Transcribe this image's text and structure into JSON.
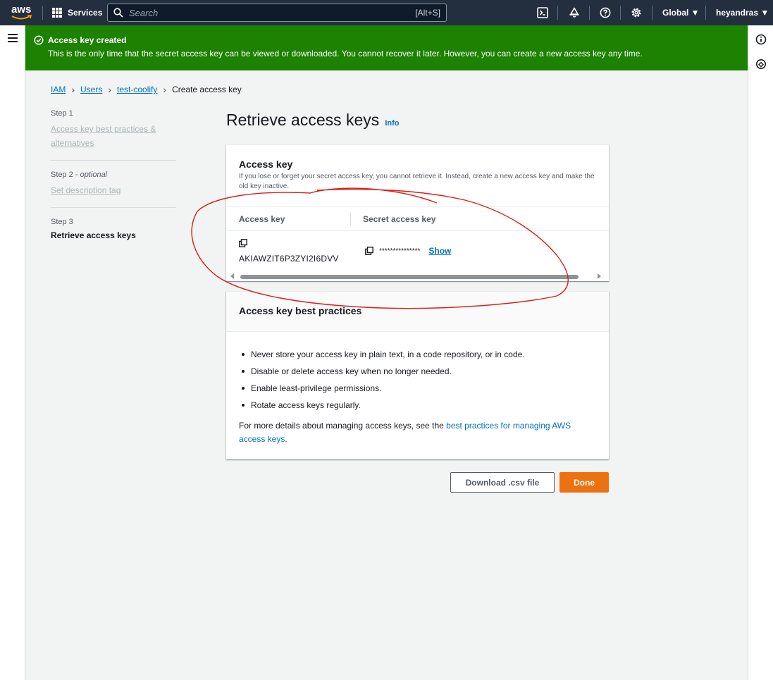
{
  "topnav": {
    "logo_text": "aws",
    "services_label": "Services",
    "search_placeholder": "Search",
    "search_shortcut": "[Alt+S]",
    "region_label": "Global ▼",
    "account_label": "heyandras ▼"
  },
  "flash": {
    "title": "Access key created",
    "message": "This is the only time that the secret access key can be viewed or downloaded. You cannot recover it later. However, you can create a new access key any time.",
    "color": "#1d8102"
  },
  "breadcrumb": {
    "items": [
      "IAM",
      "Users",
      "test-coolify"
    ],
    "current": "Create access key"
  },
  "steps": [
    {
      "num": "Step 1",
      "label": "Access key best practices & alternatives"
    },
    {
      "num": "Step 2",
      "num_suffix": "optional",
      "label": "Set description tag"
    },
    {
      "num": "Step 3",
      "label": "Retrieve access keys"
    }
  ],
  "page": {
    "title": "Retrieve access keys",
    "info_label": "Info"
  },
  "access_key_panel": {
    "title": "Access key",
    "description": "If you lose or forget your secret access key, you cannot retrieve it. Instead, create a new access key and make the old key inactive.",
    "columns": [
      "Access key",
      "Secret access key"
    ],
    "access_key_value": "AKIAWZIT6P3ZYI2I6DVV",
    "secret_masked": "***************",
    "show_label": "Show"
  },
  "best_practices": {
    "title": "Access key best practices",
    "items": [
      "Never store your access key in plain text, in a code repository, or in code.",
      "Disable or delete access key when no longer needed.",
      "Enable least-privilege permissions.",
      "Rotate access keys regularly."
    ],
    "more_prefix": "For more details about managing access keys, see the ",
    "more_link": "best practices for managing AWS access keys",
    "more_suffix": "."
  },
  "actions": {
    "download_label": "Download .csv file",
    "done_label": "Done",
    "accent_color": "#ec7211"
  },
  "icons": {
    "menu": "hamburger-icon",
    "search": "search-icon",
    "cloudshell": "cloudshell-icon",
    "notifications": "bell-icon",
    "help": "help-icon",
    "settings": "gear-icon",
    "info_panel": "info-icon",
    "feedback": "feedback-icon",
    "copy": "copy-icon",
    "success": "check-circle-icon"
  }
}
